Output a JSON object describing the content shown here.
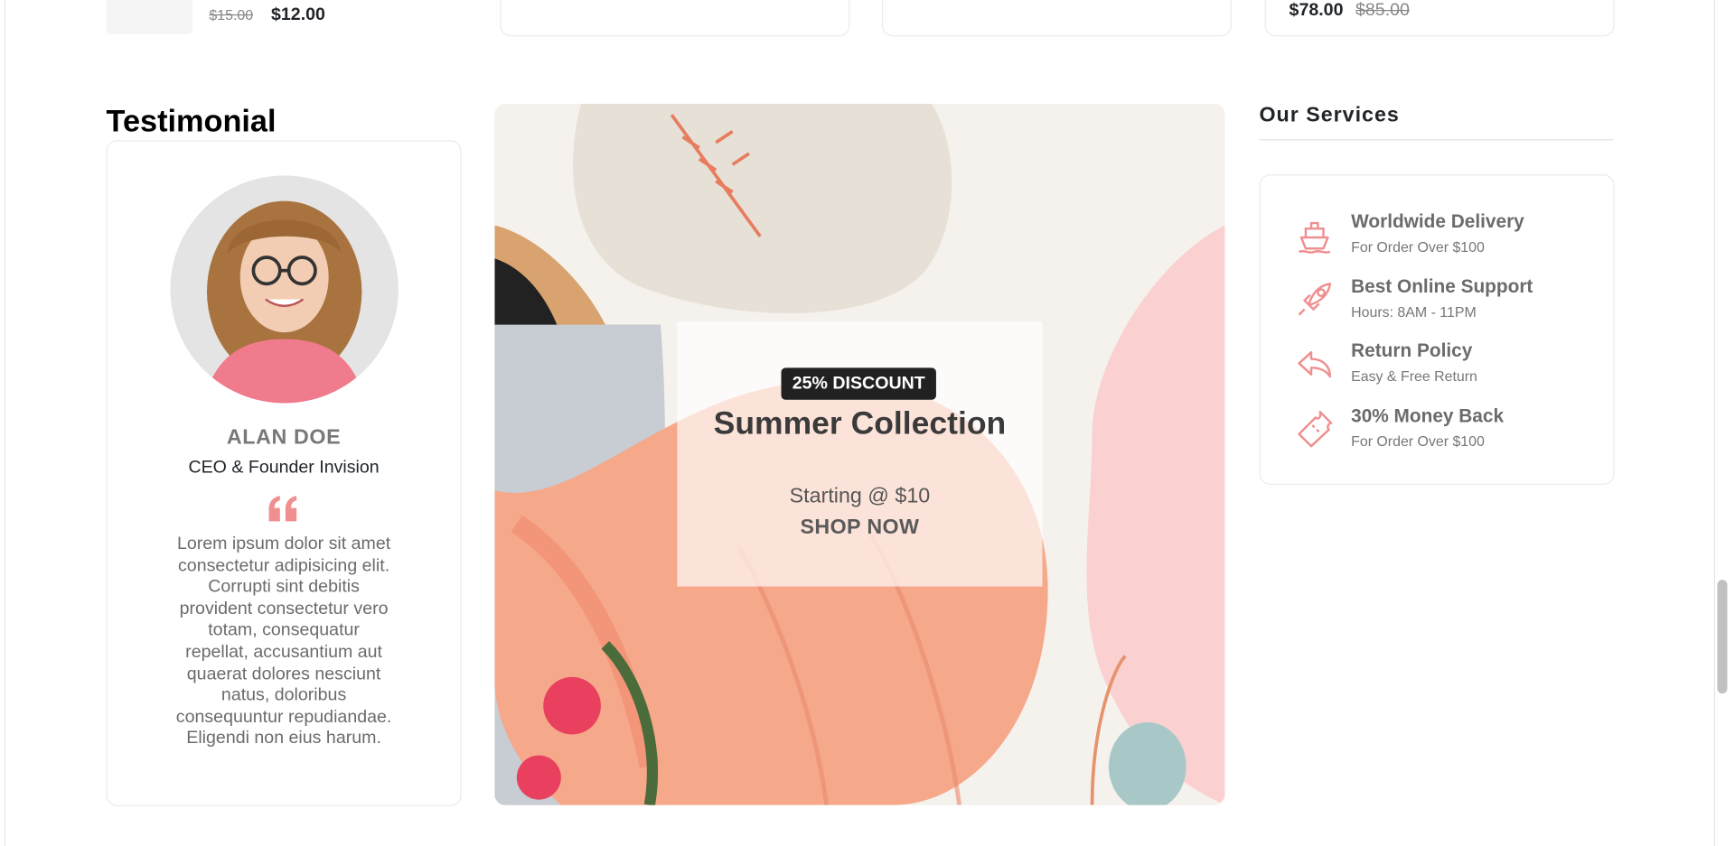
{
  "top_products": {
    "left_card": {
      "old_price": "$15.00",
      "new_price": "$12.00"
    },
    "right_card": {
      "new_price": "$78.00",
      "old_price": "$85.00"
    }
  },
  "testimonial": {
    "section_title": "Testimonial",
    "name": "ALAN DOE",
    "role": "CEO & Founder Invision",
    "text": "Lorem ipsum dolor sit amet consectetur adipisicing elit. Corrupti sint debitis provident consectetur vero totam, consequatur repellat, accusantium aut quaerat dolores nesciunt natus, doloribus consequuntur repudiandae. Eligendi non eius harum."
  },
  "banner": {
    "badge": "25% DISCOUNT",
    "title": "Summer Collection",
    "subtitle": "Starting @ $10",
    "cta": "SHOP NOW"
  },
  "services": {
    "title": "Our Services",
    "items": [
      {
        "icon": "boat-icon",
        "name": "Worldwide Delivery",
        "desc": "For Order Over $100"
      },
      {
        "icon": "rocket-icon",
        "name": "Best Online Support",
        "desc": "Hours: 8AM - 11PM"
      },
      {
        "icon": "arrow-undo-icon",
        "name": "Return Policy",
        "desc": "Easy & Free Return"
      },
      {
        "icon": "ticket-icon",
        "name": "30% Money Back",
        "desc": "For Order Over $100"
      }
    ]
  },
  "colors": {
    "accent": "#ef8f8f",
    "text_dark": "#212529",
    "text_muted": "#787878",
    "border": "#ebebeb"
  }
}
